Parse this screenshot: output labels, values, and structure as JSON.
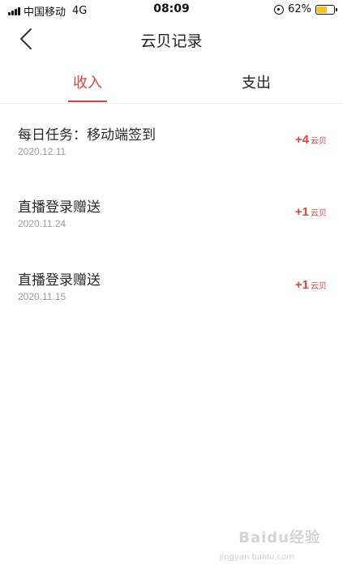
{
  "status_bar": {
    "carrier": "中国移动",
    "network": "4G",
    "time": "08:09",
    "battery_percent": "62%",
    "battery_level": 0.62,
    "icons": [
      "signal-icon",
      "orientation-lock-icon",
      "battery-icon"
    ]
  },
  "nav": {
    "title": "云贝记录",
    "back_icon": "chevron-left-icon"
  },
  "tabs": [
    {
      "label": "收入",
      "active": true
    },
    {
      "label": "支出",
      "active": false
    }
  ],
  "records": [
    {
      "title": "每日任务：移动端签到",
      "date": "2020.12.11",
      "amount": "+4",
      "unit": "云贝"
    },
    {
      "title": "直播登录赠送",
      "date": "2020.11.24",
      "amount": "+1",
      "unit": "云贝"
    },
    {
      "title": "直播登录赠送",
      "date": "2020.11.15",
      "amount": "+1",
      "unit": "云贝"
    }
  ],
  "watermark": {
    "text": "Baidu经验",
    "sub": "jingyan.baidu.com"
  },
  "colors": {
    "accent": "#e5413a",
    "text": "#222222",
    "subtext": "#9b9b9b",
    "battery": "#f3c21a"
  }
}
